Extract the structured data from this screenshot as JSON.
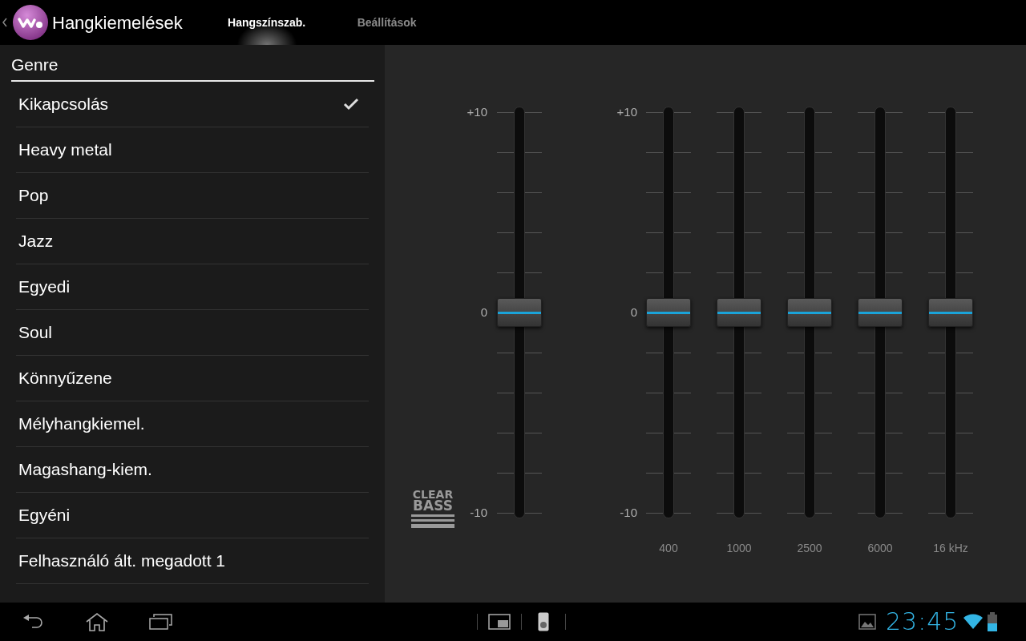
{
  "app_bar": {
    "title": "Hangkiemelések",
    "tabs": [
      {
        "label": "Hangszínszab.",
        "selected": true
      },
      {
        "label": "Beállítások",
        "selected": false
      }
    ]
  },
  "genre_list": {
    "header": "Genre",
    "items": [
      {
        "label": "Kikapcsolás",
        "selected": true
      },
      {
        "label": "Heavy metal",
        "selected": false
      },
      {
        "label": "Pop",
        "selected": false
      },
      {
        "label": "Jazz",
        "selected": false
      },
      {
        "label": "Egyedi",
        "selected": false
      },
      {
        "label": "Soul",
        "selected": false
      },
      {
        "label": "Könnyűzene",
        "selected": false
      },
      {
        "label": "Mélyhangkiemel.",
        "selected": false
      },
      {
        "label": "Magashang-kiem.",
        "selected": false
      },
      {
        "label": "Egyéni",
        "selected": false
      },
      {
        "label": "Felhasználó ált. megadott 1",
        "selected": false
      }
    ]
  },
  "clear_bass": {
    "logo_top": "CLEAR",
    "logo_bottom": "BASS",
    "scale": [
      "+10",
      "0",
      "-10"
    ],
    "level": 0.5
  },
  "equalizer": {
    "scale": [
      "+10",
      "0",
      "-10"
    ],
    "bands": [
      {
        "label": "400",
        "level": 0.5
      },
      {
        "label": "1000",
        "level": 0.5
      },
      {
        "label": "2500",
        "level": 0.5
      },
      {
        "label": "6000",
        "level": 0.5
      },
      {
        "label": "16 kHz",
        "level": 0.5
      }
    ]
  },
  "status_bar": {
    "time": "23:45"
  }
}
